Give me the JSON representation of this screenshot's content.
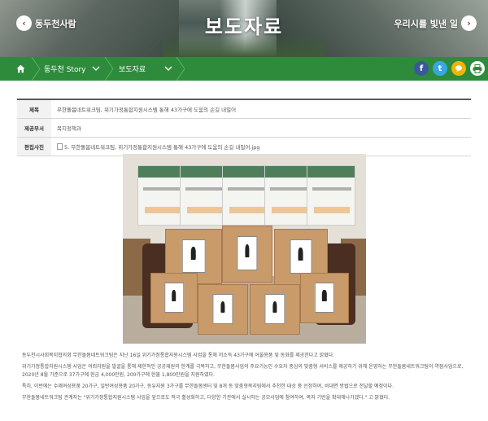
{
  "banner": {
    "title": "보도자료",
    "prev_label": "동두천사람",
    "next_label": "우리시를 빛낸 일"
  },
  "navbar": {
    "crumbs": [
      {
        "label": "동두천 Story"
      },
      {
        "label": "보도자료"
      }
    ],
    "social": [
      "facebook-icon",
      "twitter-icon",
      "kakao-icon",
      "print-icon"
    ],
    "colors": {
      "bar": "#2e8b3c",
      "facebook": "#3b5998",
      "twitter": "#3aa6e0",
      "kakao": "#f0b400"
    }
  },
  "info": {
    "rows": [
      {
        "label": "제목",
        "value": "무한돌봄네트워크팀, 위기가정통합지원시스템 통해 43가구에 도움의 손길 내밀어"
      },
      {
        "label": "제공부서",
        "value": "복지정책과"
      },
      {
        "label": "편집사진",
        "value": "5. 무한돌봄네트워크팀, 위기가정통합지원시스템 통해 43가구에 도움의 손길 내밀어.jpg"
      }
    ]
  },
  "photo": {
    "alt": "선물 상자와 쇼핑백 사진"
  },
  "body": {
    "paragraphs": [
      "동두천시사회복지협의회 무한돌봄네트워크팀은 지난 16일 위기가정통합지원시스템 사업을 통해 저소득 43가구에 어울용품 및 동화를 제공한다고 밝혔다.",
      "위기가정통합지원시스템 사업은 의뢰자원을 발굴을 통해 제한적인 공공재원의 한계를 극복하고, 무한돌봄사업의 주요기능인 수요자 중심의 맞춤형 서비스를 제공하기 위해 운영하는 무한돌봄네트워크팀의 역점사업으로, 2020년 8월 기준으로 37가구에 현금 4,000만원, 200가구에 현물 1,800만원을 지원하였다.",
      "특히, 이번에는 수제여성용품 20가구, 일반여성용품 20가구, 동유지원 3가구를 무한돌봄센터 및 8개 동 맞춤형복지팀에서 추천한 대상 중 선정하여, 비대면 방법으로 전달할 예정이다.",
      "무한돌봄네트워크팀 관계자는 \"위기가정통합지원시스템 사업을 앞으로도 적극 활성화하고, 다양한 기관에서 실시하는 공모사업에 참여하여, 복지 기반을 확대해나가겠다.\" 고 밝혔다."
    ]
  }
}
